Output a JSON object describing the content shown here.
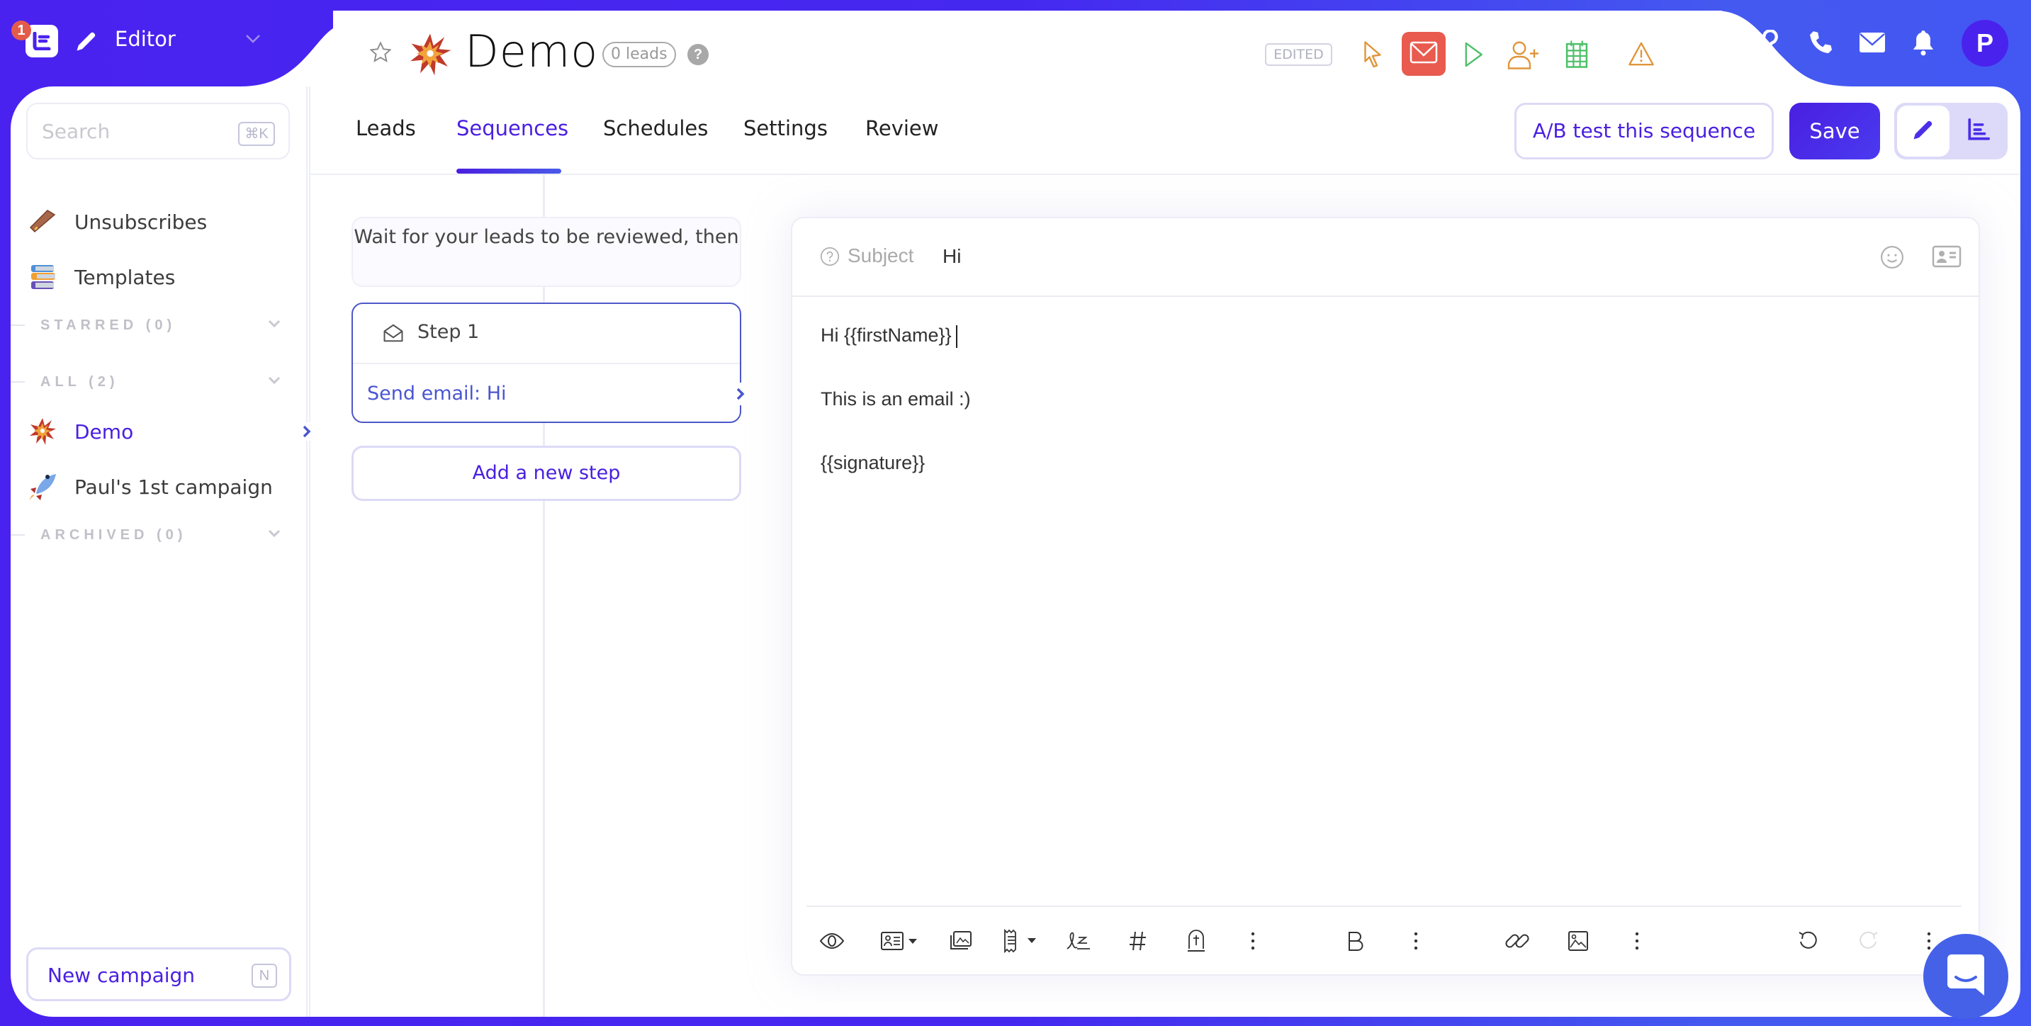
{
  "app": {
    "notification_count": "1",
    "mode_label": "Editor",
    "logo_letter": "E"
  },
  "header": {
    "campaign_emoji": "explosion",
    "title": "Demo",
    "leads_badge": "0 leads",
    "help": "?",
    "status_badge": "EDITED",
    "status_icons": [
      "cursor-icon",
      "mail-icon",
      "play-icon",
      "add-user-icon",
      "calendar-icon",
      "warning-icon"
    ],
    "right_icons": [
      "help-icon",
      "phone-icon",
      "mail-icon",
      "bell-icon"
    ],
    "avatar_letter": "P",
    "colors": {
      "brand": "#4a1fe0",
      "mail_active_bg": "#e85b4e",
      "cursor": "#e0953a",
      "play": "#4cbf68",
      "add_user": "#e0953a",
      "calendar": "#4cbf68",
      "warning": "#e0953a"
    }
  },
  "sidebar": {
    "search_placeholder": "Search",
    "search_shortcut": "⌘K",
    "items": [
      {
        "label": "Unsubscribes",
        "icon": "coffin-icon"
      },
      {
        "label": "Templates",
        "icon": "books-icon"
      }
    ],
    "sections": [
      {
        "label": "STARRED (0)"
      },
      {
        "label": "ALL (2)"
      },
      {
        "label": "ARCHIVED (0)"
      }
    ],
    "campaigns": [
      {
        "label": "Demo",
        "icon": "explosion-icon",
        "active": true
      },
      {
        "label": "Paul's 1st campaign",
        "icon": "rocket-icon",
        "active": false
      }
    ],
    "new_campaign_label": "New campaign",
    "new_campaign_shortcut": "N"
  },
  "tabs": [
    {
      "label": "Leads",
      "active": false
    },
    {
      "label": "Sequences",
      "active": true
    },
    {
      "label": "Schedules",
      "active": false
    },
    {
      "label": "Settings",
      "active": false
    },
    {
      "label": "Review",
      "active": false
    }
  ],
  "actions": {
    "ab_test_label": "A/B test this sequence",
    "save_label": "Save",
    "view_toggle": [
      "edit-view",
      "stats-view"
    ]
  },
  "sequence": {
    "wait_text": "Wait for your leads to be reviewed, then",
    "steps": [
      {
        "title": "Step 1",
        "action": "Send email: Hi"
      }
    ],
    "add_step_label": "Add a new step"
  },
  "editor": {
    "subject_label": "Subject",
    "subject_value": "Hi",
    "body_lines": [
      "Hi {{firstName}}",
      "This is an email :)",
      "{{signature}}"
    ],
    "toolbar": [
      "preview",
      "variables",
      "gallery",
      "templates",
      "signature",
      "hashtag",
      "unsubscribe",
      "more",
      "bold",
      "more",
      "link",
      "image",
      "more",
      "undo",
      "redo",
      "more"
    ]
  }
}
